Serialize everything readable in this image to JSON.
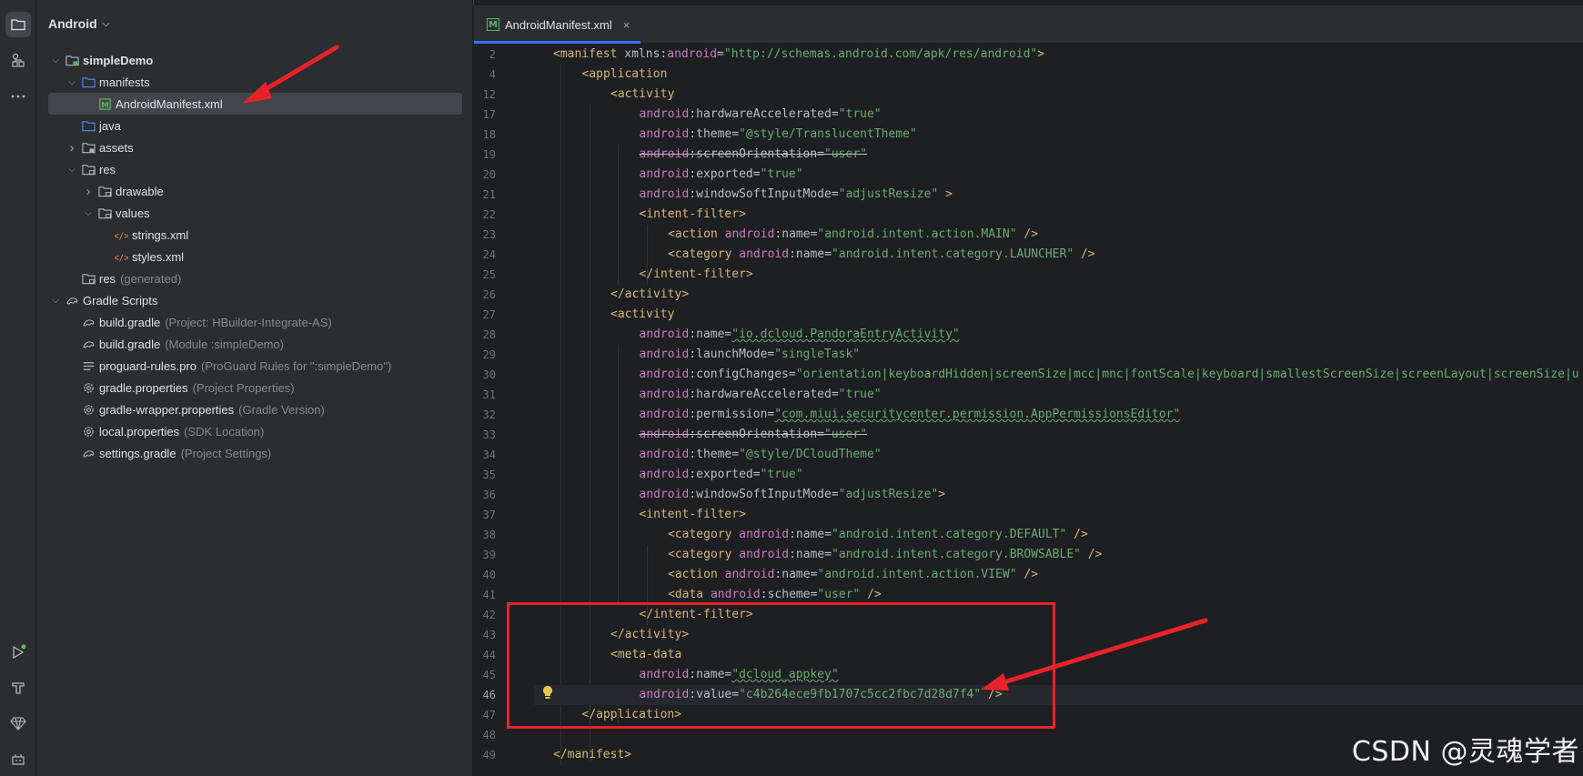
{
  "activity_bar": {
    "top_icons": [
      "folder-icon",
      "structure-icon",
      "more-icon"
    ],
    "bottom_icons": [
      "run-icon",
      "build-icon",
      "gem-icon",
      "git-icon"
    ]
  },
  "project": {
    "view_label": "Android",
    "tree": [
      {
        "label": "simpleDemo",
        "hint": "",
        "icon": "module-icon",
        "arrow": "down",
        "bold": true
      },
      {
        "label": "manifests",
        "hint": "",
        "icon": "folder-icon",
        "arrow": "down"
      },
      {
        "label": "AndroidManifest.xml",
        "hint": "",
        "icon": "manifest-file-icon",
        "arrow": "",
        "selected": true
      },
      {
        "label": "java",
        "hint": "",
        "icon": "folder-icon",
        "arrow": ""
      },
      {
        "label": "assets",
        "hint": "",
        "icon": "assets-folder-icon",
        "arrow": "right"
      },
      {
        "label": "res",
        "hint": "",
        "icon": "res-folder-icon",
        "arrow": "down"
      },
      {
        "label": "drawable",
        "hint": "",
        "icon": "res-folder-icon",
        "arrow": "right"
      },
      {
        "label": "values",
        "hint": "",
        "icon": "res-folder-icon",
        "arrow": "down"
      },
      {
        "label": "strings.xml",
        "hint": "",
        "icon": "xml-file-icon",
        "arrow": ""
      },
      {
        "label": "styles.xml",
        "hint": "",
        "icon": "xml-file-icon",
        "arrow": ""
      },
      {
        "label": "res",
        "hint": "(generated)",
        "icon": "res-folder-icon",
        "arrow": ""
      },
      {
        "label": "Gradle Scripts",
        "hint": "",
        "icon": "gradle-icon",
        "arrow": "down"
      },
      {
        "label": "build.gradle",
        "hint": "(Project: HBuilder-Integrate-AS)",
        "icon": "gradle-icon",
        "arrow": ""
      },
      {
        "label": "build.gradle",
        "hint": "(Module :simpleDemo)",
        "icon": "gradle-icon",
        "arrow": ""
      },
      {
        "label": "proguard-rules.pro",
        "hint": "(ProGuard Rules for \":simpleDemo\")",
        "icon": "text-file-icon",
        "arrow": ""
      },
      {
        "label": "gradle.properties",
        "hint": "(Project Properties)",
        "icon": "settings-file-icon",
        "arrow": ""
      },
      {
        "label": "gradle-wrapper.properties",
        "hint": "(Gradle Version)",
        "icon": "settings-file-icon",
        "arrow": ""
      },
      {
        "label": "local.properties",
        "hint": "(SDK Location)",
        "icon": "settings-file-icon",
        "arrow": ""
      },
      {
        "label": "settings.gradle",
        "hint": "(Project Settings)",
        "icon": "gradle-icon",
        "arrow": ""
      }
    ]
  },
  "editor": {
    "tab_label": "AndroidManifest.xml",
    "close_glyph": "×",
    "lines": [
      {
        "n": "2",
        "tokens": [
          [
            "tag",
            "<manifest "
          ],
          [
            "attr",
            "xmlns"
          ],
          [
            "plain",
            ":"
          ],
          [
            "ns",
            "android"
          ],
          [
            "plain",
            "="
          ],
          [
            "val",
            "\"http://schemas.android.com/apk/res/android\""
          ],
          [
            "tag",
            ">"
          ]
        ],
        "indent": 0
      },
      {
        "n": "4",
        "tokens": [
          [
            "tag",
            "<application"
          ]
        ],
        "indent": 1
      },
      {
        "n": "12",
        "tokens": [
          [
            "tag",
            "<activity"
          ]
        ],
        "indent": 2
      },
      {
        "n": "17",
        "tokens": [
          [
            "ns",
            "android"
          ],
          [
            "plain",
            ":hardwareAccelerated="
          ],
          [
            "val",
            "\"true\""
          ]
        ],
        "indent": 3
      },
      {
        "n": "18",
        "tokens": [
          [
            "ns",
            "android"
          ],
          [
            "plain",
            ":theme="
          ],
          [
            "val",
            "\"@style/TranslucentTheme\""
          ]
        ],
        "indent": 3
      },
      {
        "n": "19",
        "tokens": [
          [
            "ns",
            "android"
          ],
          [
            "plain",
            ":screenOrientation="
          ],
          [
            "val",
            "\"user\""
          ]
        ],
        "indent": 3,
        "strike": true
      },
      {
        "n": "20",
        "tokens": [
          [
            "ns",
            "android"
          ],
          [
            "plain",
            ":exported="
          ],
          [
            "val",
            "\"true\""
          ]
        ],
        "indent": 3
      },
      {
        "n": "21",
        "tokens": [
          [
            "ns",
            "android"
          ],
          [
            "plain",
            ":windowSoftInputMode="
          ],
          [
            "val",
            "\"adjustResize\""
          ],
          [
            "tag",
            " >"
          ]
        ],
        "indent": 3
      },
      {
        "n": "22",
        "tokens": [
          [
            "tag",
            "<intent-filter>"
          ]
        ],
        "indent": 3
      },
      {
        "n": "23",
        "tokens": [
          [
            "tag",
            "<action "
          ],
          [
            "ns",
            "android"
          ],
          [
            "plain",
            ":name="
          ],
          [
            "val",
            "\"android.intent.action.MAIN\""
          ],
          [
            "tag",
            " />"
          ]
        ],
        "indent": 4
      },
      {
        "n": "24",
        "tokens": [
          [
            "tag",
            "<category "
          ],
          [
            "ns",
            "android"
          ],
          [
            "plain",
            ":name="
          ],
          [
            "val",
            "\"android.intent.category.LAUNCHER\""
          ],
          [
            "tag",
            " />"
          ]
        ],
        "indent": 4
      },
      {
        "n": "25",
        "tokens": [
          [
            "tag",
            "</intent-filter>"
          ]
        ],
        "indent": 3
      },
      {
        "n": "26",
        "tokens": [
          [
            "tag",
            "</activity>"
          ]
        ],
        "indent": 2
      },
      {
        "n": "27",
        "tokens": [
          [
            "tag",
            "<activity"
          ]
        ],
        "indent": 2
      },
      {
        "n": "28",
        "tokens": [
          [
            "ns",
            "android"
          ],
          [
            "plain",
            ":name="
          ],
          [
            "val",
            "\"io.dcloud.PandoraEntryActivity\""
          ]
        ],
        "indent": 3
      },
      {
        "n": "29",
        "tokens": [
          [
            "ns",
            "android"
          ],
          [
            "plain",
            ":launchMode="
          ],
          [
            "val",
            "\"singleTask\""
          ]
        ],
        "indent": 3
      },
      {
        "n": "30",
        "tokens": [
          [
            "ns",
            "android"
          ],
          [
            "plain",
            ":configChanges="
          ],
          [
            "val",
            "\"orientation|keyboardHidden|screenSize|mcc|mnc|fontScale|keyboard|smallestScreenSize|screenLayout|screenSize|u"
          ]
        ],
        "indent": 3
      },
      {
        "n": "31",
        "tokens": [
          [
            "ns",
            "android"
          ],
          [
            "plain",
            ":hardwareAccelerated="
          ],
          [
            "val",
            "\"true\""
          ]
        ],
        "indent": 3
      },
      {
        "n": "32",
        "tokens": [
          [
            "ns",
            "android"
          ],
          [
            "plain",
            ":permission="
          ],
          [
            "val",
            "\"com.miui.securitycenter.permission.AppPermissionsEditor\""
          ]
        ],
        "indent": 3
      },
      {
        "n": "33",
        "tokens": [
          [
            "ns",
            "android"
          ],
          [
            "plain",
            ":screenOrientation="
          ],
          [
            "val",
            "\"user\""
          ]
        ],
        "indent": 3,
        "strike": true
      },
      {
        "n": "34",
        "tokens": [
          [
            "ns",
            "android"
          ],
          [
            "plain",
            ":theme="
          ],
          [
            "val",
            "\"@style/DCloudTheme\""
          ]
        ],
        "indent": 3
      },
      {
        "n": "35",
        "tokens": [
          [
            "ns",
            "android"
          ],
          [
            "plain",
            ":exported="
          ],
          [
            "val",
            "\"true\""
          ]
        ],
        "indent": 3
      },
      {
        "n": "36",
        "tokens": [
          [
            "ns",
            "android"
          ],
          [
            "plain",
            ":windowSoftInputMode="
          ],
          [
            "val",
            "\"adjustResize\""
          ],
          [
            "tag",
            ">"
          ]
        ],
        "indent": 3
      },
      {
        "n": "37",
        "tokens": [
          [
            "tag",
            "<intent-filter>"
          ]
        ],
        "indent": 3
      },
      {
        "n": "38",
        "tokens": [
          [
            "tag",
            "<category "
          ],
          [
            "ns",
            "android"
          ],
          [
            "plain",
            ":name="
          ],
          [
            "val",
            "\"android.intent.category.DEFAULT\""
          ],
          [
            "tag",
            " />"
          ]
        ],
        "indent": 4
      },
      {
        "n": "39",
        "tokens": [
          [
            "tag",
            "<category "
          ],
          [
            "ns",
            "android"
          ],
          [
            "plain",
            ":name="
          ],
          [
            "val",
            "\"android.intent.category.BROWSABLE\""
          ],
          [
            "tag",
            " />"
          ]
        ],
        "indent": 4
      },
      {
        "n": "40",
        "tokens": [
          [
            "tag",
            "<action "
          ],
          [
            "ns",
            "android"
          ],
          [
            "plain",
            ":name="
          ],
          [
            "val",
            "\"android.intent.action.VIEW\""
          ],
          [
            "tag",
            " />"
          ]
        ],
        "indent": 4
      },
      {
        "n": "41",
        "tokens": [
          [
            "tag",
            "<data "
          ],
          [
            "ns",
            "android"
          ],
          [
            "plain",
            ":scheme="
          ],
          [
            "val",
            "\"user\""
          ],
          [
            "tag",
            " />"
          ]
        ],
        "indent": 4
      },
      {
        "n": "42",
        "tokens": [
          [
            "tag",
            "</intent-filter>"
          ]
        ],
        "indent": 3
      },
      {
        "n": "43",
        "tokens": [
          [
            "tag",
            "</activity>"
          ]
        ],
        "indent": 2
      },
      {
        "n": "44",
        "tokens": [
          [
            "tag",
            "<meta-data"
          ]
        ],
        "indent": 2
      },
      {
        "n": "45",
        "tokens": [
          [
            "ns",
            "android"
          ],
          [
            "plain",
            ":name="
          ],
          [
            "val",
            "\"dcloud_appkey\""
          ]
        ],
        "indent": 3
      },
      {
        "n": "46",
        "tokens": [
          [
            "ns",
            "android"
          ],
          [
            "plain",
            ":value="
          ],
          [
            "val",
            "\"c4b264ece9fb1707c5cc2fbc7d28d7f4\""
          ],
          [
            "tag",
            " />"
          ]
        ],
        "indent": 3,
        "current": true
      },
      {
        "n": "47",
        "tokens": [
          [
            "tag",
            "</application>"
          ]
        ],
        "indent": 1
      },
      {
        "n": "48",
        "tokens": [],
        "indent": 0
      },
      {
        "n": "49",
        "tokens": [
          [
            "tag",
            "</manifest>"
          ]
        ],
        "indent": 0
      }
    ]
  },
  "watermark": "CSDN @灵魂学者",
  "colors": {
    "annotation_red": "#e8222a",
    "accent_blue": "#3574f0"
  }
}
